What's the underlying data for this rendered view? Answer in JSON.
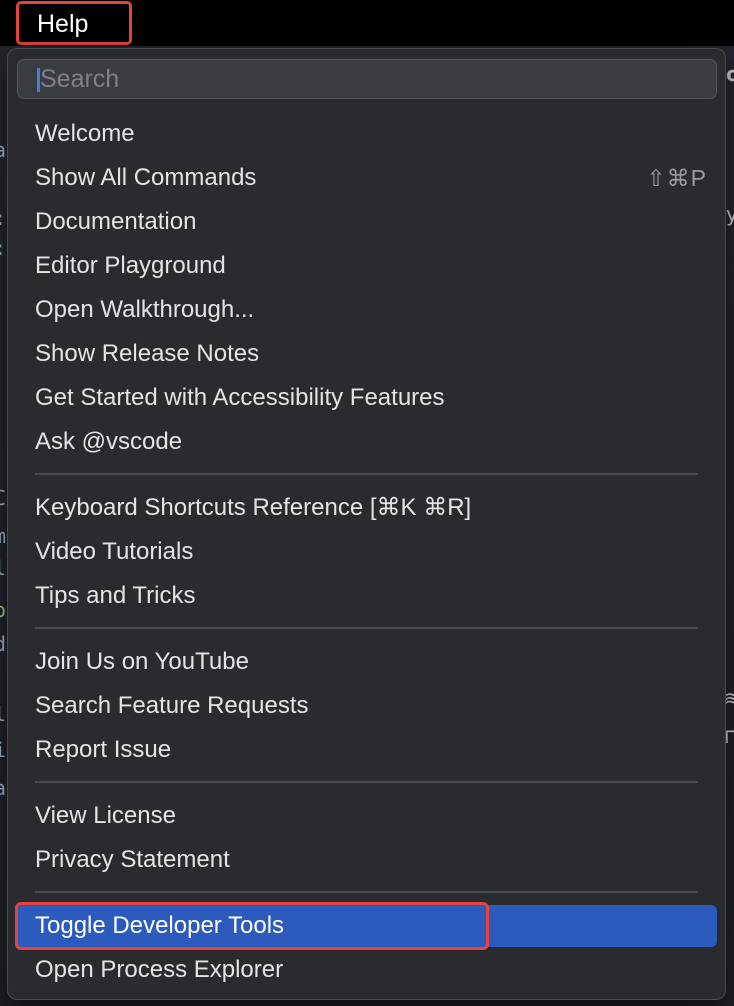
{
  "menubar": {
    "help_label": "Help"
  },
  "search": {
    "placeholder": "Search"
  },
  "menu": {
    "groups": [
      {
        "items": [
          {
            "label": "Welcome",
            "shortcut": ""
          },
          {
            "label": "Show All Commands",
            "shortcut": "⇧⌘P"
          },
          {
            "label": "Documentation",
            "shortcut": ""
          },
          {
            "label": "Editor Playground",
            "shortcut": ""
          },
          {
            "label": "Open Walkthrough...",
            "shortcut": ""
          },
          {
            "label": "Show Release Notes",
            "shortcut": ""
          },
          {
            "label": "Get Started with Accessibility Features",
            "shortcut": ""
          },
          {
            "label": "Ask @vscode",
            "shortcut": ""
          }
        ]
      },
      {
        "items": [
          {
            "label": "Keyboard Shortcuts Reference [⌘K ⌘R]",
            "shortcut": ""
          },
          {
            "label": "Video Tutorials",
            "shortcut": ""
          },
          {
            "label": "Tips and Tricks",
            "shortcut": ""
          }
        ]
      },
      {
        "items": [
          {
            "label": "Join Us on YouTube",
            "shortcut": ""
          },
          {
            "label": "Search Feature Requests",
            "shortcut": ""
          },
          {
            "label": "Report Issue",
            "shortcut": ""
          }
        ]
      },
      {
        "items": [
          {
            "label": "View License",
            "shortcut": ""
          },
          {
            "label": "Privacy Statement",
            "shortcut": ""
          }
        ]
      },
      {
        "items": [
          {
            "label": "Toggle Developer Tools",
            "shortcut": "",
            "highlighted": true
          },
          {
            "label": "Open Process Explorer",
            "shortcut": ""
          }
        ]
      }
    ]
  },
  "colors": {
    "accent": "#2c5bbd",
    "annotation": "#e5433b",
    "menu_bg": "#2a2b2e",
    "menubar_bg": "#000000"
  }
}
